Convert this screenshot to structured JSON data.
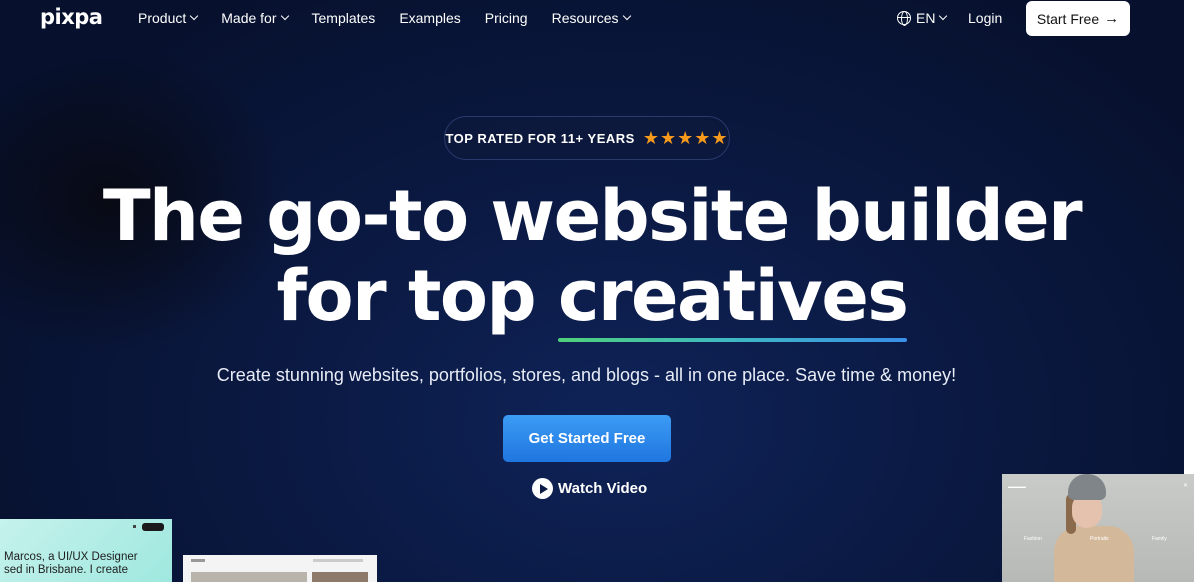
{
  "nav": {
    "logo": "pixpa",
    "links": [
      {
        "label": "Product",
        "dropdown": true
      },
      {
        "label": "Made for",
        "dropdown": true
      },
      {
        "label": "Templates",
        "dropdown": false
      },
      {
        "label": "Examples",
        "dropdown": false
      },
      {
        "label": "Pricing",
        "dropdown": false
      },
      {
        "label": "Resources",
        "dropdown": true
      }
    ],
    "language": "EN",
    "login": "Login",
    "start_free": "Start Free",
    "start_free_arrow": "→"
  },
  "hero": {
    "badge_text": "TOP RATED FOR 11+ YEARS",
    "rating_stars": 5,
    "headline_line1": "The go-to website builder",
    "headline_line2_prefix": "for top ",
    "headline_line2_emphasis": "creatives",
    "subheadline": "Create stunning websites, portfolios, stores, and blogs - all in one place. Save time & money!",
    "cta_label": "Get Started Free",
    "watch_label": "Watch Video"
  },
  "previews": {
    "left_card_text": "Marcos, a UI/UX Designer\nsed in Brisbane. I create",
    "right_card_labels": [
      "Fashion",
      "Portraits",
      "Family"
    ]
  },
  "colors": {
    "background": "#0b1a44",
    "cta": "#2b88ec",
    "star": "#f79a1b",
    "underline_start": "#4fd17a",
    "underline_end": "#3a8fe8"
  }
}
